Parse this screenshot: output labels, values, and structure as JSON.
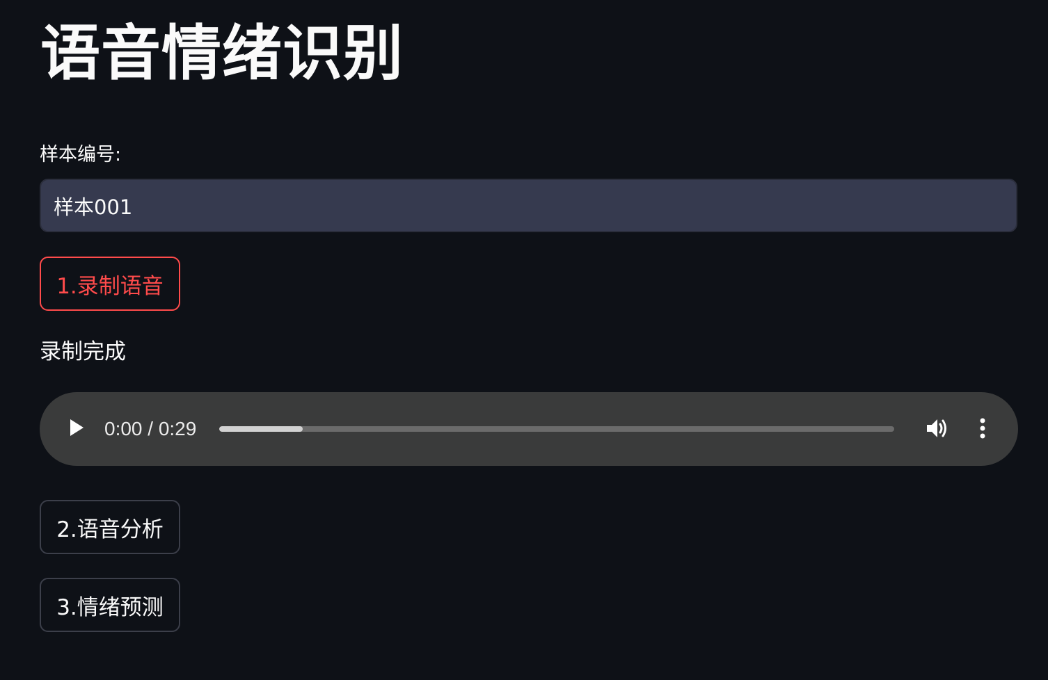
{
  "page": {
    "title": "语音情绪识别"
  },
  "sample_field": {
    "label": "样本编号:",
    "value": "样本001"
  },
  "buttons": {
    "record": "1.录制语音",
    "analyze": "2.语音分析",
    "predict": "3.情绪预测"
  },
  "status": {
    "text": "录制完成"
  },
  "audio_player": {
    "time_display": "0:00 / 0:29",
    "buffered_fraction": 0.124,
    "icons": [
      "play-icon",
      "volume-icon",
      "more-options-icon"
    ]
  },
  "colors": {
    "background": "#0e1117",
    "accent": "#ff4b4b",
    "input_bg": "#363a4f",
    "player_bg": "#3a3b3b"
  }
}
